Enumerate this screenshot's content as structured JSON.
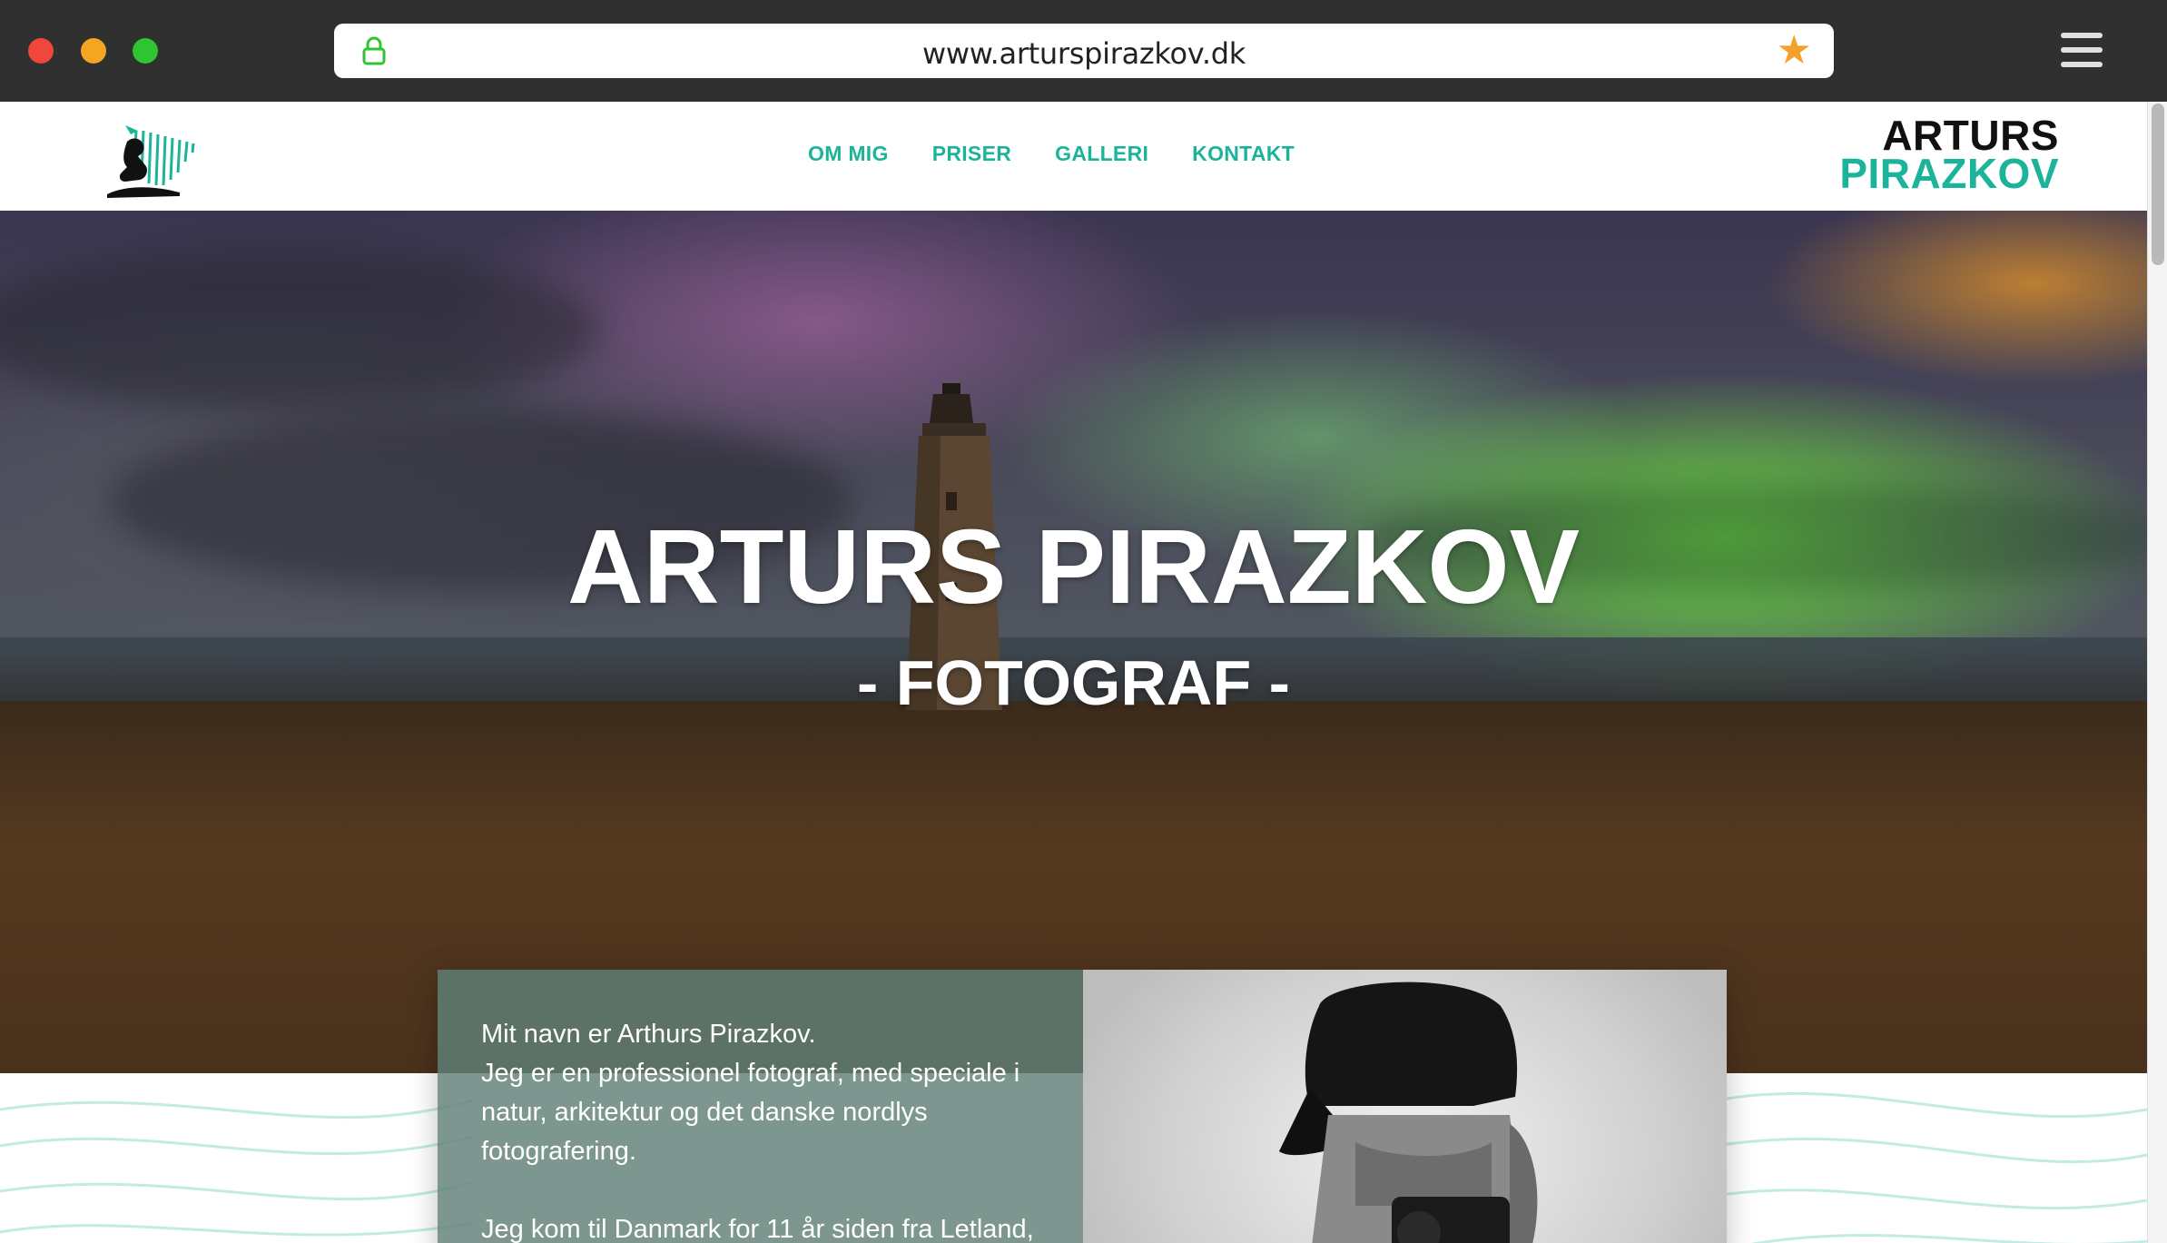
{
  "browser": {
    "url": "www.arturspirazkov.dk"
  },
  "nav": {
    "items": [
      {
        "label": "OM MIG"
      },
      {
        "label": "PRISER"
      },
      {
        "label": "GALLERI"
      },
      {
        "label": "KONTAKT"
      }
    ]
  },
  "brand": {
    "line1": "ARTURS",
    "line2": "PIRAZKOV"
  },
  "hero": {
    "title": "ARTURS PIRAZKOV",
    "subtitle": "- FOTOGRAF -"
  },
  "about": {
    "paragraph1_line1": "Mit navn er Arthurs Pirazkov.",
    "paragraph1_line2": "Jeg er en professionel fotograf, med speciale i natur, arkitektur og det danske nordlys fotografering.",
    "paragraph2": "Jeg kom til Danmark for 11 år siden fra Letland,"
  },
  "colors": {
    "accent": "#1bb39a",
    "chrome": "#303030",
    "star": "#f3a12a"
  },
  "icons": {
    "lock": "lock-icon",
    "bookmark": "star-icon",
    "menu": "hamburger-menu-icon"
  }
}
